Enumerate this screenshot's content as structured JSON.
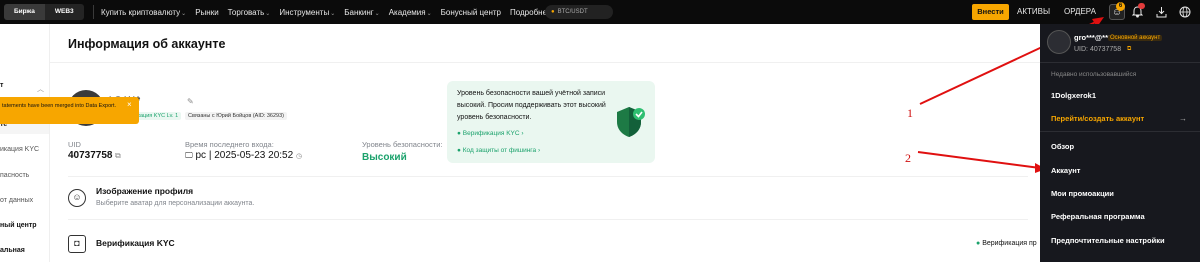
{
  "topbar": {
    "segments": [
      "Биржа",
      "WEB3"
    ],
    "nav": [
      "Купить криптовалюту",
      "Рынки",
      "Торговать",
      "Инструменты",
      "Банкинг",
      "Академия",
      "Бонусный центр",
      "Подробнее"
    ],
    "search_placeholder": "BTC/USDT",
    "deposit_label": "Внести",
    "assets_label": "АКТИВЫ",
    "orders_label": "ОРДЕРА",
    "profile_badge": "6"
  },
  "left_sidebar": {
    "items": [
      "т",
      "те",
      "икация KYC",
      "пасность",
      "от данных",
      "ный центр",
      "альная"
    ]
  },
  "toast": {
    "text": "tatements have been merged into Data Export.",
    "close": "×"
  },
  "page": {
    "title": "Информация об аккаунте"
  },
  "profile": {
    "username": "*@****",
    "kyc_tag": "Верификация KYC Lv. 1",
    "linked_tag": "Связаны с Юрий Бойцов (AID: 36293)",
    "uid_label": "UID",
    "uid_value": "40737758",
    "last_login_label": "Время последнего входа:",
    "last_login_value": "pc  |  2025-05-23 20:52",
    "security_label": "Уровень безопасности:",
    "security_value": "Высокий"
  },
  "security_box": {
    "text": "Уровень безопасности вашей учётной записи высокий. Просим поддерживать этот высокий уровень безопасности.",
    "link_kyc": "Верификация KYC ›",
    "link_phishing": "Код защиты от фишинга ›"
  },
  "rows": [
    {
      "title": "Изображение профиля",
      "desc": "Выберите аватар для персонализации аккаунта."
    },
    {
      "title": "Верификация KYC",
      "desc": "",
      "status": "Верификация пр"
    }
  ],
  "annotations": [
    "1",
    "2"
  ],
  "dropdown": {
    "user": "gro***@****",
    "main_account": "Основной аккаунт",
    "uid": "UID: 40737758",
    "recent_label": "Недавно использовавшийся",
    "recent_account": "1Dolgxerok1",
    "switch_label": "Перейти/создать аккаунт",
    "menu": [
      "Обзор",
      "Аккаунт",
      "Мои промоакции",
      "Реферальная программа",
      "Предпочтительные настройки"
    ]
  },
  "colors": {
    "accent": "#f7a600",
    "success": "#1ba26c",
    "annotation": "#d01010"
  }
}
